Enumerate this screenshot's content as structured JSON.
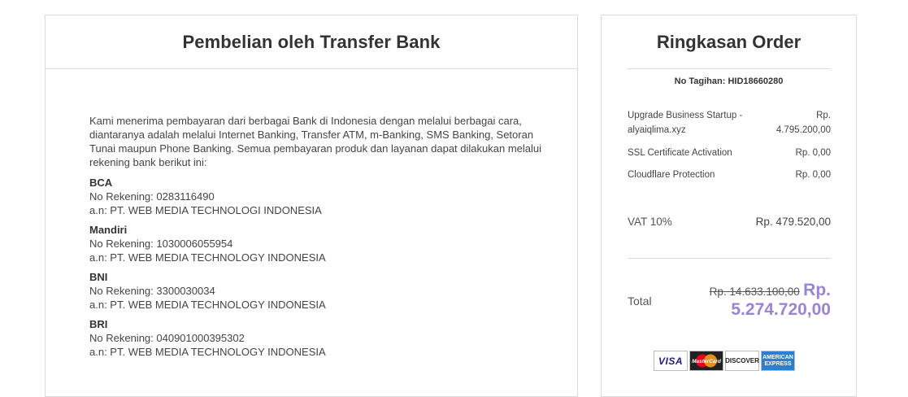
{
  "left_panel": {
    "title": "Pembelian oleh Transfer Bank",
    "intro": "Kami menerima pembayaran dari berbagai Bank di Indonesia dengan melalui berbagai cara, diantaranya adalah melalui Internet Banking, Transfer ATM, m-Banking, SMS Banking, Setoran Tunai maupun Phone Banking. Semua pembayaran produk dan layanan dapat dilakukan melalui rekening bank berikut ini:",
    "banks": [
      {
        "name": "BCA",
        "account": "No Rekening: 0283116490",
        "holder": "a.n: PT. WEB MEDIA TECHNOLOGI INDONESIA"
      },
      {
        "name": "Mandiri",
        "account": "No Rekening: 1030006055954",
        "holder": "a.n: PT. WEB MEDIA TECHNOLOGY INDONESIA"
      },
      {
        "name": "BNI",
        "account": "No Rekening: 3300030034",
        "holder": "a.n: PT. WEB MEDIA TECHNOLOGY INDONESIA"
      },
      {
        "name": "BRI",
        "account": "No Rekening: 040901000395302",
        "holder": "a.n: PT. WEB MEDIA TECHNOLOGY INDONESIA"
      }
    ]
  },
  "summary": {
    "title": "Ringkasan Order",
    "invoice_no": "No Tagihan: HID18660280",
    "items": [
      {
        "desc": "Upgrade Business Startup - alyaiqlima.xyz",
        "amount": "Rp. 4.795.200,00"
      },
      {
        "desc": "SSL Certificate Activation",
        "amount": "Rp. 0,00"
      },
      {
        "desc": "Cloudflare Protection",
        "amount": "Rp. 0,00"
      }
    ],
    "vat_label": "VAT 10%",
    "vat_amount": "Rp. 479.520,00",
    "total_label": "Total",
    "old_total": "Rp. 14.633.100,00",
    "new_total": "Rp. 5.274.720,00",
    "accent_color": "#9b84d2",
    "payment_cards": [
      {
        "icon": "visa-icon",
        "label": "VISA"
      },
      {
        "icon": "mastercard-icon",
        "label": "MasterCard"
      },
      {
        "icon": "discover-icon",
        "label": "DISCOVER"
      },
      {
        "icon": "amex-icon",
        "label": "AMERICAN EXPRESS"
      }
    ]
  }
}
